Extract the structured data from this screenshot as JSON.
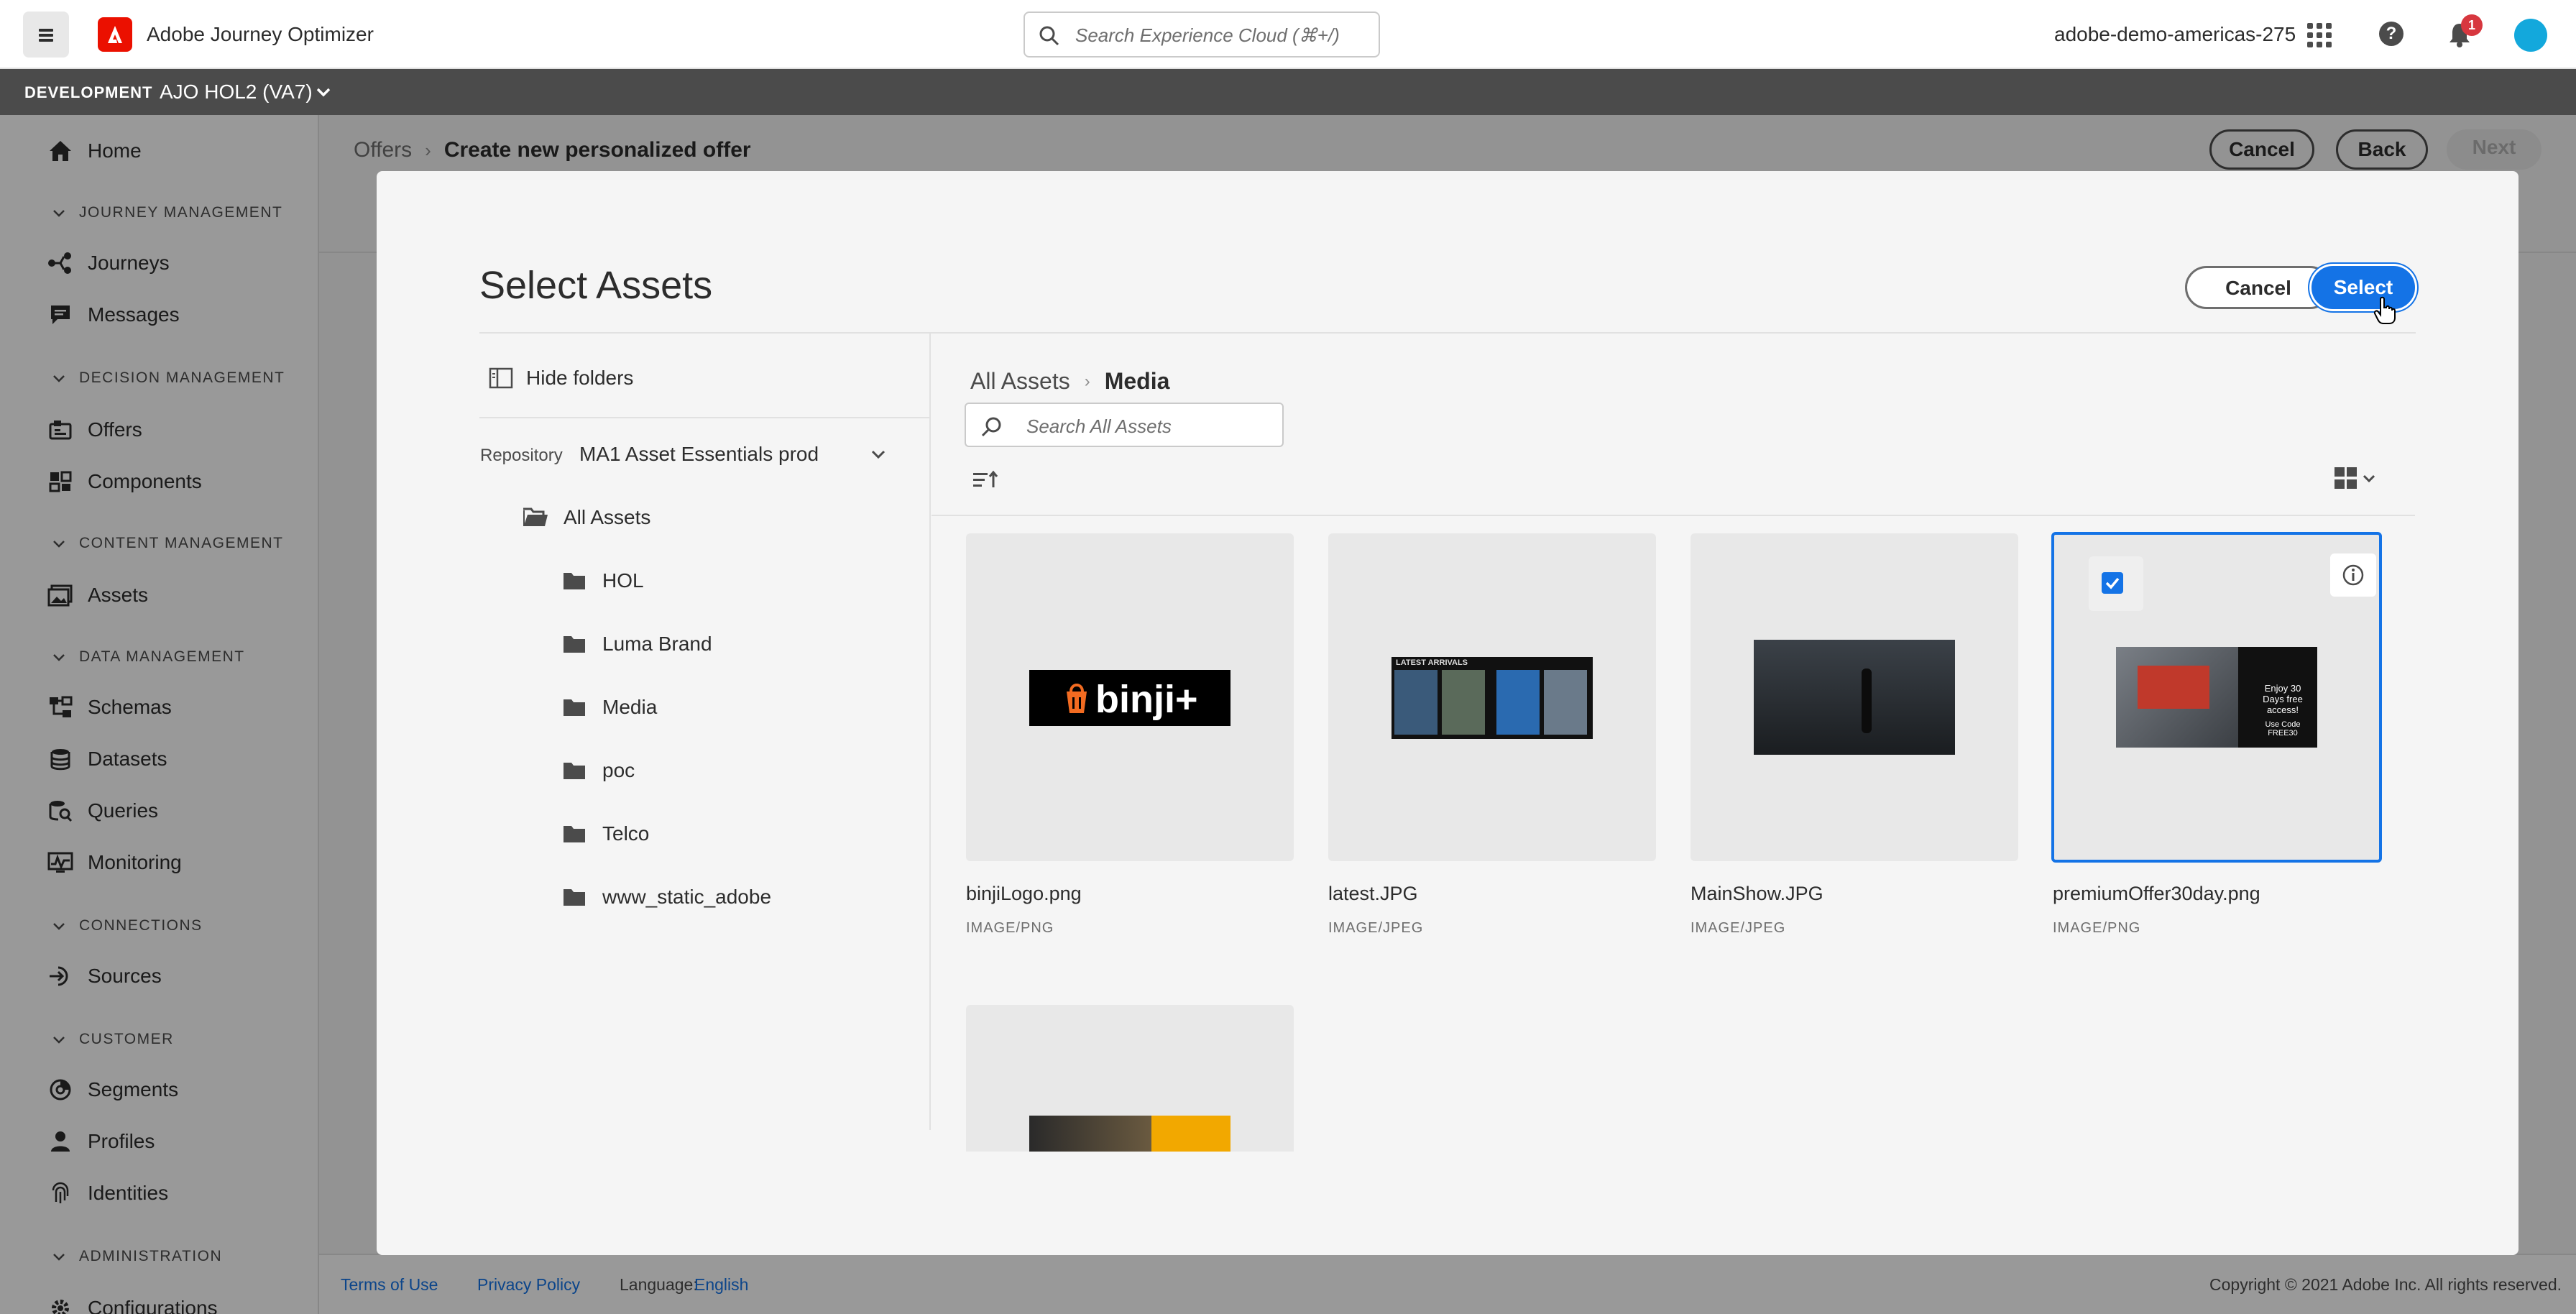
{
  "topbar": {
    "app_title": "Adobe Journey Optimizer",
    "search_placeholder": "Search Experience Cloud (⌘+/)",
    "org_name": "adobe-demo-americas-275",
    "notification_count": "1"
  },
  "sandbox": {
    "environment": "DEVELOPMENT",
    "name": "AJO HOL2 (VA7)"
  },
  "sidebar": {
    "home": "Home",
    "sections": {
      "journey_management": "JOURNEY MANAGEMENT",
      "decision_management": "DECISION MANAGEMENT",
      "content_management": "CONTENT MANAGEMENT",
      "data_management": "DATA MANAGEMENT",
      "connections": "CONNECTIONS",
      "customer": "CUSTOMER",
      "administration": "ADMINISTRATION"
    },
    "items": {
      "journeys": "Journeys",
      "messages": "Messages",
      "offers": "Offers",
      "components": "Components",
      "assets": "Assets",
      "schemas": "Schemas",
      "datasets": "Datasets",
      "queries": "Queries",
      "monitoring": "Monitoring",
      "sources": "Sources",
      "segments": "Segments",
      "profiles": "Profiles",
      "identities": "Identities",
      "configurations": "Configurations"
    }
  },
  "page": {
    "breadcrumb_parent": "Offers",
    "breadcrumb_current": "Create new personalized offer",
    "cancel": "Cancel",
    "back": "Back",
    "next": "Next"
  },
  "footer": {
    "terms": "Terms of Use",
    "privacy": "Privacy Policy",
    "language_label": "Language:",
    "language_value": "English",
    "copyright": "Copyright © 2021 Adobe Inc. All rights reserved."
  },
  "modal": {
    "title": "Select Assets",
    "cancel": "Cancel",
    "select": "Select",
    "hide_folders": "Hide folders",
    "repository_label": "Repository",
    "repository_value": "MA1 Asset Essentials prod",
    "root_folder": "All Assets",
    "folders": [
      "HOL",
      "Luma Brand",
      "Media",
      "poc",
      "Telco",
      "www_static_adobe"
    ],
    "breadcrumb_root": "All Assets",
    "breadcrumb_current": "Media",
    "search_placeholder": "Search All Assets",
    "assets": [
      {
        "name": "binjiLogo.png",
        "type": "IMAGE/PNG",
        "thumb_text": "binji+",
        "selected": false
      },
      {
        "name": "latest.JPG",
        "type": "IMAGE/JPEG",
        "thumb_text": "LATEST ARRIVALS",
        "selected": false
      },
      {
        "name": "MainShow.JPG",
        "type": "IMAGE/JPEG",
        "selected": false
      },
      {
        "name": "premiumOffer30day.png",
        "type": "IMAGE/PNG",
        "thumb_text": "Enjoy 30 Days free access!",
        "thumb_text2": "Use Code FREE30",
        "selected": true
      },
      {
        "name": "",
        "type": "",
        "selected": false
      }
    ]
  }
}
